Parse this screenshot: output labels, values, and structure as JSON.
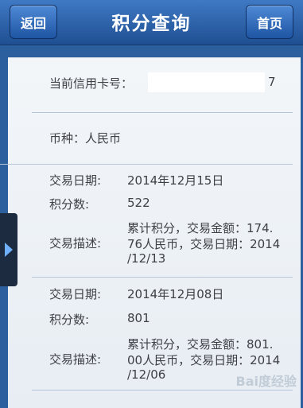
{
  "header": {
    "title": "积分查询",
    "back_label": "返回",
    "home_label": "首页"
  },
  "account": {
    "card_label": "当前信用卡号：",
    "card_tail": "7",
    "currency_label": "币种：人民币"
  },
  "labels": {
    "date": "交易日期:",
    "points": "积分数:",
    "desc": "交易描述:"
  },
  "transactions": [
    {
      "date": "2014年12月15日",
      "points": "522",
      "desc_lines": [
        "累计积分，交易金额：174.",
        "76人民币，交易日期：2014",
        "/12/13"
      ]
    },
    {
      "date": "2014年12月08日",
      "points": "801",
      "desc_lines": [
        "累计积分，交易金额：801.",
        "00人民币，交易日期：2014",
        "/12/06"
      ]
    }
  ],
  "watermark": "Bai度经验"
}
